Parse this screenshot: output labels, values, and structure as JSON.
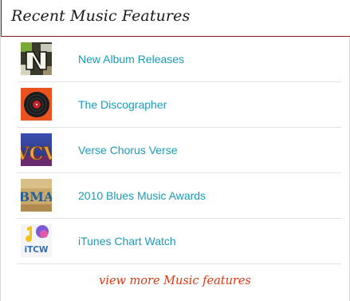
{
  "header": {
    "title": "Recent Music Features"
  },
  "items": [
    {
      "label": "New Album Releases",
      "icon": "new-album-releases-icon"
    },
    {
      "label": "The Discographer",
      "icon": "vinyl-record-icon"
    },
    {
      "label": "Verse Chorus Verse",
      "icon": "verse-chorus-verse-icon",
      "icon_text": "VCV"
    },
    {
      "label": "2010 Blues Music Awards",
      "icon": "blues-music-awards-icon",
      "icon_text": "BMA"
    },
    {
      "label": "iTunes Chart Watch",
      "icon": "itunes-chart-watch-icon",
      "icon_text": "iTCW"
    }
  ],
  "more_link": "view more Music features",
  "colors": {
    "accent_border": "#8b1a1a",
    "link": "#1a9bb8",
    "more_link": "#d9370f"
  }
}
